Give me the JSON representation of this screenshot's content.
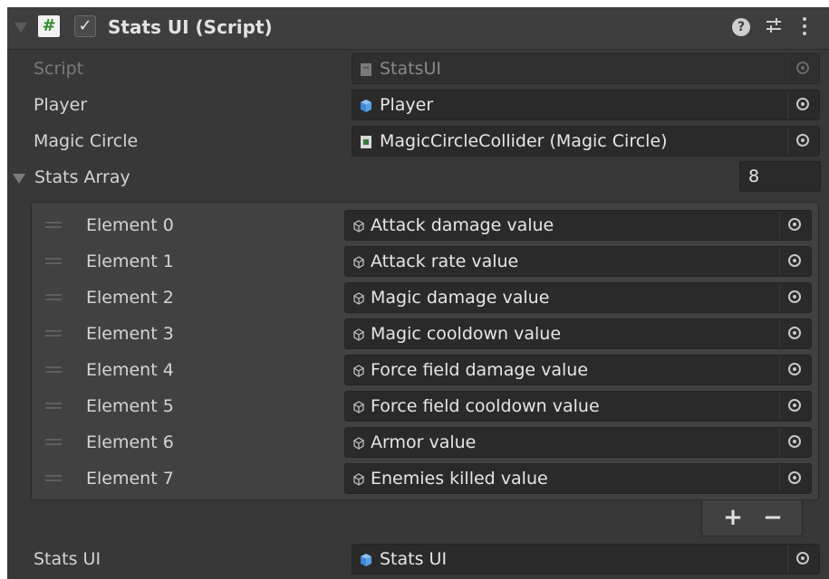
{
  "component": {
    "title": "Stats UI (Script)",
    "enabled": true,
    "icons": [
      "script-hash-icon",
      "enabled-checkbox",
      "help-icon",
      "presets-icon",
      "more-icon"
    ]
  },
  "fields": {
    "script": {
      "label": "Script",
      "value": "StatsUI"
    },
    "player": {
      "label": "Player",
      "value": "Player"
    },
    "magic_circle": {
      "label": "Magic Circle",
      "value": "MagicCircleCollider (Magic Circle)"
    },
    "stats_ui": {
      "label": "Stats UI",
      "value": "Stats UI"
    }
  },
  "stats_array": {
    "label": "Stats Array",
    "size": "8",
    "elements": [
      {
        "label": "Element 0",
        "value": "Attack damage value"
      },
      {
        "label": "Element 1",
        "value": "Attack rate value"
      },
      {
        "label": "Element 2",
        "value": "Magic damage value"
      },
      {
        "label": "Element 3",
        "value": "Magic cooldown value"
      },
      {
        "label": "Element 4",
        "value": "Force field damage value"
      },
      {
        "label": "Element 5",
        "value": "Force field cooldown value"
      },
      {
        "label": "Element 6",
        "value": "Armor value"
      },
      {
        "label": "Element 7",
        "value": "Enemies killed value"
      }
    ],
    "add_label": "+",
    "remove_label": "−"
  },
  "colors": {
    "background": "#383838",
    "header": "#3e3e3e",
    "field": "#2a2a2a",
    "text": "#d4d4d4",
    "prefab_blue": "#5aa0e6"
  }
}
